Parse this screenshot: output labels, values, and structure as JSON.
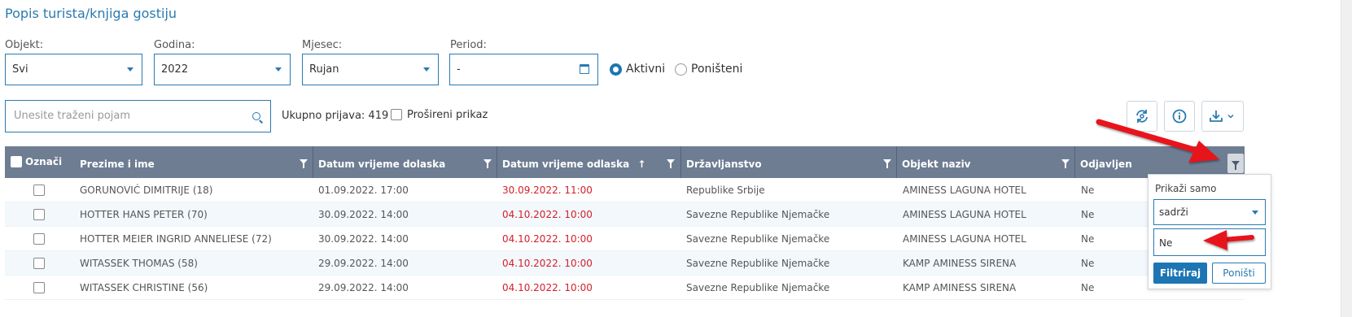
{
  "page_title": "Popis turista/knjiga gostiju",
  "filters": {
    "objekt": {
      "label": "Objekt:",
      "value": "Svi"
    },
    "godina": {
      "label": "Godina:",
      "value": "2022"
    },
    "mjesec": {
      "label": "Mjesec:",
      "value": "Rujan"
    },
    "period": {
      "label": "Period:",
      "value": "-"
    }
  },
  "status": {
    "aktivni": {
      "label": "Aktivni",
      "checked": true
    },
    "ponisteni": {
      "label": "Poništeni",
      "checked": false
    }
  },
  "search": {
    "placeholder": "Unesite traženi pojam"
  },
  "total": "Ukupno prijava: 419",
  "expanded_view": {
    "label": "Prošireni prikaz",
    "checked": false
  },
  "toolbar": {
    "refresh_icon": "refresh-icon",
    "info_icon": "info-icon",
    "download_icon": "download-icon"
  },
  "table": {
    "columns": [
      {
        "label": "Označi"
      },
      {
        "label": "Prezime i ime"
      },
      {
        "label": "Datum vrijeme dolaska"
      },
      {
        "label": "Datum vrijeme odlaska",
        "sort": "↑"
      },
      {
        "label": "Državljanstvo"
      },
      {
        "label": "Objekt naziv"
      },
      {
        "label": "Odjavljen"
      }
    ],
    "rows": [
      {
        "name": "GORUNOVIĆ DIMITRIJE (18)",
        "arrival": "01.09.2022. 17:00",
        "departure": "30.09.2022. 11:00",
        "citizenship": "Republike Srbije",
        "object": "AMINESS LAGUNA HOTEL",
        "checked_out": "Ne"
      },
      {
        "name": "HOTTER HANS PETER (70)",
        "arrival": "30.09.2022. 14:00",
        "departure": "04.10.2022. 10:00",
        "citizenship": "Savezne Republike Njemačke",
        "object": "AMINESS LAGUNA HOTEL",
        "checked_out": "Ne"
      },
      {
        "name": "HOTTER MEIER INGRID ANNELIESE (72)",
        "arrival": "30.09.2022. 14:00",
        "departure": "04.10.2022. 10:00",
        "citizenship": "Savezne Republike Njemačke",
        "object": "AMINESS LAGUNA HOTEL",
        "checked_out": "Ne"
      },
      {
        "name": "WITASSEK THOMAS (58)",
        "arrival": "29.09.2022. 14:00",
        "departure": "04.10.2022. 10:00",
        "citizenship": "Savezne Republike Njemačke",
        "object": "KAMP AMINESS SIRENA",
        "checked_out": "Ne"
      },
      {
        "name": "WITASSEK CHRISTINE (56)",
        "arrival": "29.09.2022. 14:00",
        "departure": "04.10.2022. 10:00",
        "citizenship": "Savezne Republike Njemačke",
        "object": "KAMP AMINESS SIRENA",
        "checked_out": "Ne"
      }
    ]
  },
  "filter_popup": {
    "title": "Prikaži samo",
    "operator": "sadrži",
    "value": "Ne",
    "apply_label": "Filtriraj",
    "cancel_label": "Poništi"
  },
  "colors": {
    "accent": "#1d75b3",
    "header_bg": "#6e7d92",
    "departure_text": "#d3202a",
    "annotation_arrow": "#e8141c"
  }
}
